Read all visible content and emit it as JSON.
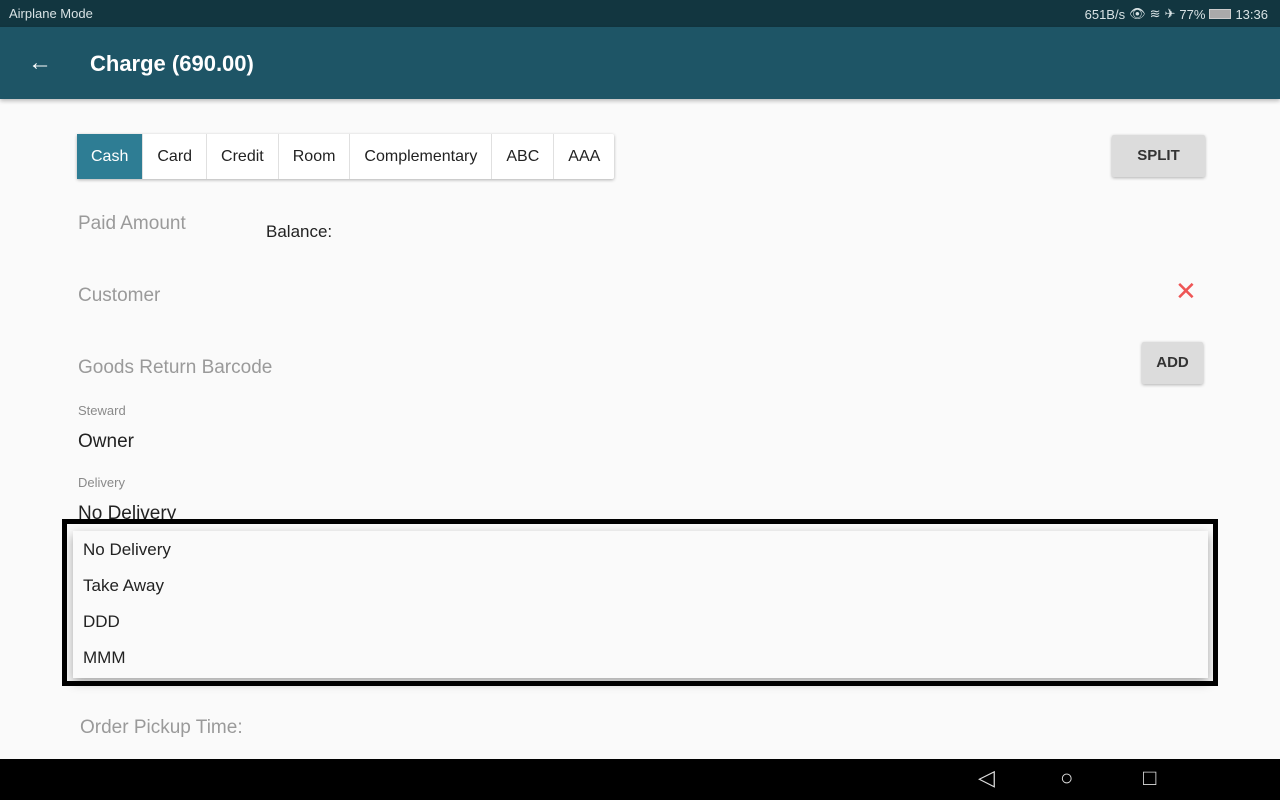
{
  "status_bar": {
    "left": "Airplane Mode",
    "speed": "651B/s",
    "icons": [
      "eye-icon",
      "wifi-icon",
      "airplane-icon"
    ],
    "battery": "77%",
    "time": "13:36"
  },
  "app_bar": {
    "title": "Charge (690.00)"
  },
  "payment_tabs": [
    {
      "label": "Cash",
      "active": true
    },
    {
      "label": "Card"
    },
    {
      "label": "Credit"
    },
    {
      "label": "Room"
    },
    {
      "label": "Complementary"
    },
    {
      "label": "ABC"
    },
    {
      "label": "AAA"
    }
  ],
  "split_label": "SPLIT",
  "paid_amount_placeholder": "Paid Amount",
  "balance_label": "Balance:",
  "customer_placeholder": "Customer",
  "barcode_placeholder": "Goods Return Barcode",
  "add_label": "ADD",
  "steward": {
    "label": "Steward",
    "value": "Owner"
  },
  "delivery": {
    "label": "Delivery",
    "value": "No Delivery",
    "options": [
      "No Delivery",
      "Take Away",
      "DDD",
      "MMM"
    ]
  },
  "pickup_label": "Order Pickup Time:",
  "colors": {
    "app_bar": "#1e5566",
    "active_tab": "#2e7d94",
    "close": "#e55555"
  }
}
